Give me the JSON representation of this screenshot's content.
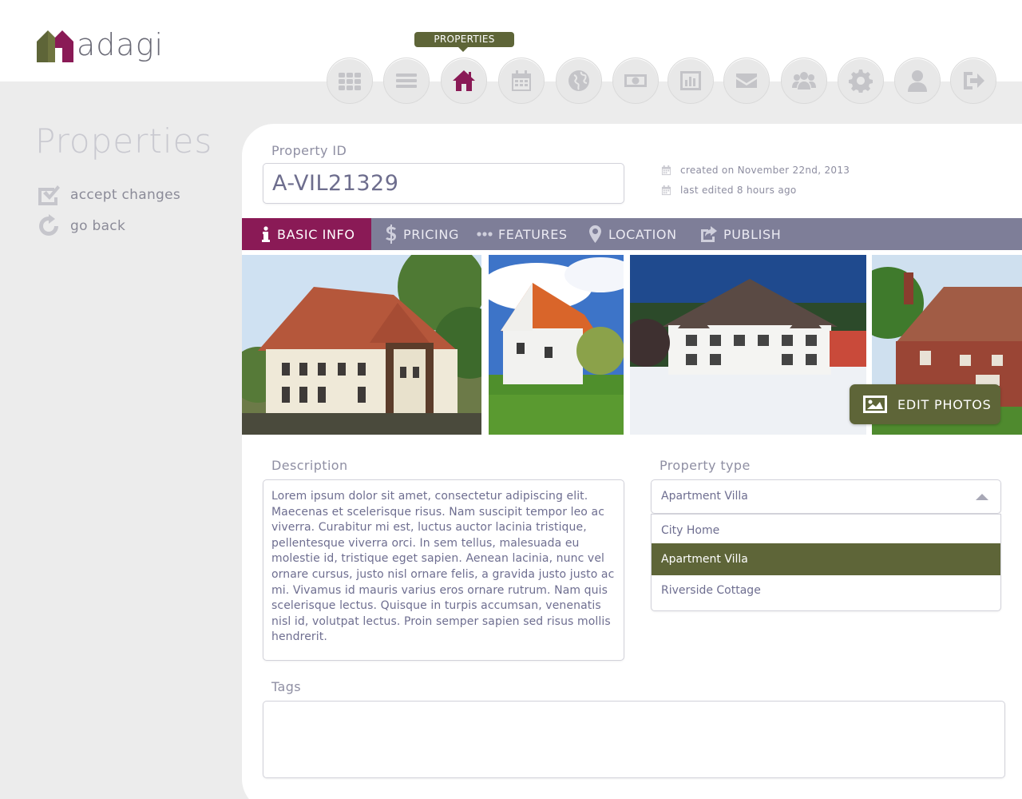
{
  "app": {
    "logo_text": "adagi"
  },
  "nav": {
    "tooltip": "PROPERTIES",
    "items": [
      {
        "icon": "grid-icon",
        "label": "Dashboard"
      },
      {
        "icon": "list-icon",
        "label": "List"
      },
      {
        "icon": "home-icon",
        "label": "Properties",
        "active": true
      },
      {
        "icon": "calendar-icon",
        "label": "Calendar"
      },
      {
        "icon": "globe-icon",
        "label": "Map"
      },
      {
        "icon": "money-icon",
        "label": "Finance"
      },
      {
        "icon": "bar-chart-icon",
        "label": "Reports"
      },
      {
        "icon": "envelope-icon",
        "label": "Messages"
      },
      {
        "icon": "users-icon",
        "label": "Clients"
      },
      {
        "icon": "gear-icon",
        "label": "Settings"
      },
      {
        "icon": "user-icon",
        "label": "Account"
      },
      {
        "icon": "logout-icon",
        "label": "Sign out"
      }
    ]
  },
  "sidebar": {
    "title": "Properties",
    "actions": [
      {
        "label": "accept changes",
        "icon": "checkbox-checked-icon"
      },
      {
        "label": "go back",
        "icon": "refresh-icon"
      }
    ]
  },
  "form": {
    "property_id_label": "Property ID",
    "property_id_value": "A-VIL21329",
    "created": "created on November 22nd, 2013",
    "edited": "last edited 8 hours ago",
    "tabs": [
      {
        "label": "BASIC INFO",
        "icon": "info-icon",
        "active": true
      },
      {
        "label": "PRICING",
        "icon": "dollar-icon"
      },
      {
        "label": "FEATURES",
        "icon": "ellipsis-icon"
      },
      {
        "label": "LOCATION",
        "icon": "map-pin-icon"
      },
      {
        "label": "PUBLISH",
        "icon": "share-icon"
      }
    ],
    "edit_photos_label": "EDIT PHOTOS",
    "description_label": "Description",
    "description": "Lorem ipsum dolor sit amet, consectetur adipiscing elit. Maecenas et scelerisque risus. Nam suscipit tempor leo ac viverra. Curabitur mi est, luctus auctor lacinia tristique, pellentesque viverra orci. In sem tellus, malesuada eu molestie id, tristique eget sapien. Aenean lacinia, nunc vel ornare cursus, justo nisl ornare felis, a gravida justo justo ac mi. Vivamus id mauris varius eros ornare rutrum. Nam quis scelerisque lectus. Quisque in turpis accumsan, venenatis nisl id, volutpat lectus. Proin semper sapien sed risus mollis hendrerit.",
    "property_type_label": "Property type",
    "property_type_value": "Apartment Villa",
    "property_type_options": [
      "City Home",
      "Apartment Villa",
      "Riverside Cottage"
    ],
    "tags_label": "Tags"
  },
  "colors": {
    "accent": "#8a1a56",
    "olive": "#5e6538",
    "tabbar": "#7e7e98"
  }
}
